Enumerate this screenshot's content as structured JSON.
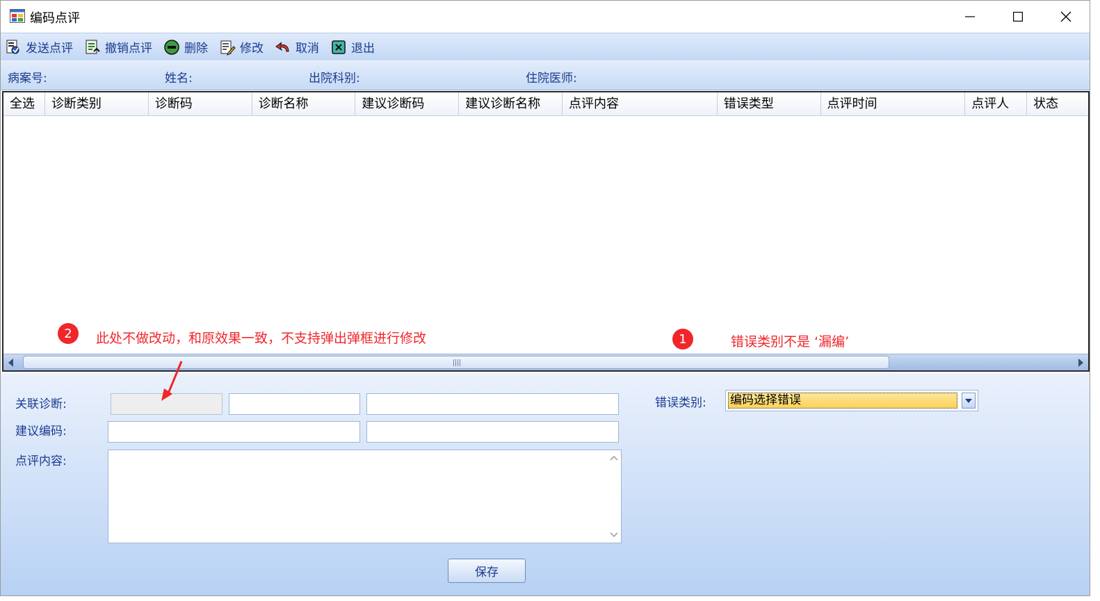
{
  "window": {
    "title": "编码点评",
    "controls": {
      "minimize": "minimize-icon",
      "maximize": "maximize-icon",
      "close": "close-icon"
    }
  },
  "toolbar": {
    "items": [
      {
        "label": "发送点评",
        "icon": "send-review-icon"
      },
      {
        "label": "撤销点评",
        "icon": "revoke-review-icon"
      },
      {
        "label": "删除",
        "icon": "delete-icon"
      },
      {
        "label": "修改",
        "icon": "edit-icon"
      },
      {
        "label": "取消",
        "icon": "undo-icon"
      },
      {
        "label": "退出",
        "icon": "exit-icon"
      }
    ]
  },
  "info": {
    "case_no_label": "病案号:",
    "name_label": "姓名:",
    "dept_label": "出院科别:",
    "doctor_label": "住院医师:"
  },
  "grid": {
    "columns": [
      "全选",
      "诊断类别",
      "诊断码",
      "诊断名称",
      "建议诊断码",
      "建议诊断名称",
      "点评内容",
      "错误类型",
      "点评时间",
      "点评人",
      "状态"
    ],
    "rows": []
  },
  "annotations": {
    "one": {
      "number": "1",
      "text": "错误类别不是 ‘漏编’"
    },
    "two": {
      "number": "2",
      "text": "此处不做改动，和原效果一致，不支持弹出弹框进行修改"
    },
    "color": "#f0262b"
  },
  "form": {
    "related_diag_label": "关联诊断:",
    "suggest_code_label": "建议编码:",
    "review_content_label": "点评内容:",
    "error_type_label": "错误类别:",
    "error_type_value": "编码选择错误",
    "save_label": "保存",
    "related_diag_values": [
      "",
      "",
      ""
    ],
    "suggest_code_values": [
      "",
      ""
    ],
    "review_content_value": ""
  },
  "colors": {
    "label_blue": "#1a3b8f",
    "toolbar_bg": "#c3d8f4",
    "combo_highlight": "#fbd25a"
  }
}
